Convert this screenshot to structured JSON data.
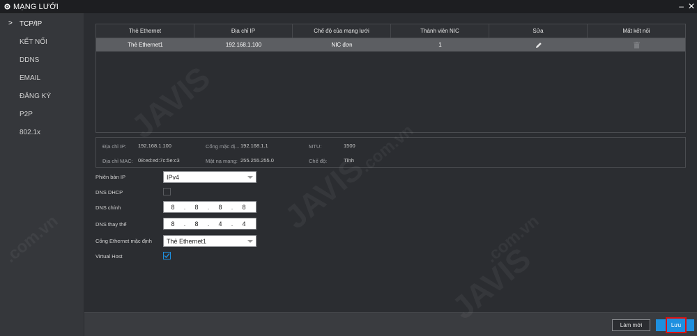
{
  "window": {
    "title": "MẠNG LƯỚI",
    "controls": {
      "minimize": "–",
      "close": "✕"
    }
  },
  "sidebar": {
    "items": [
      {
        "label": "TCP/IP",
        "active": true
      },
      {
        "label": "KẾT NỐI",
        "active": false
      },
      {
        "label": "DDNS",
        "active": false
      },
      {
        "label": "EMAIL",
        "active": false
      },
      {
        "label": "ĐĂNG KÝ",
        "active": false
      },
      {
        "label": "P2P",
        "active": false
      },
      {
        "label": "802.1x",
        "active": false
      }
    ]
  },
  "table": {
    "headers": [
      "Thẻ Ethernet",
      "Địa chỉ IP",
      "Chế độ của mạng lưới",
      "Thành viên NIC",
      "Sửa",
      "Mất kết nối"
    ],
    "rows": [
      {
        "card": "Thẻ Ethernet1",
        "ip": "192.168.1.100",
        "mode": "NIC đơn",
        "members": "1",
        "edit_icon": "pencil-icon",
        "disconnect_icon": "trash-icon"
      }
    ]
  },
  "info": {
    "ip_label": "Địa chỉ IP:",
    "ip_value": "192.168.1.100",
    "mac_label": "Địa chỉ MAC:",
    "mac_value": "08:ed:ed:7c:5e:c3",
    "gateway_label": "Cổng mặc đị...",
    "gateway_value": "192.168.1.1",
    "subnet_label": "Mặt nạ mạng:",
    "subnet_value": "255.255.255.0",
    "mtu_label": "MTU:",
    "mtu_value": "1500",
    "mode_label": "Chế độ:",
    "mode_value": "Tĩnh"
  },
  "form": {
    "ip_version": {
      "label": "Phiên bản IP",
      "value": "IPv4"
    },
    "dns_dhcp": {
      "label": "DNS DHCP",
      "checked": false
    },
    "dns_primary": {
      "label": "DNS chính",
      "octets": [
        "8",
        "8",
        "8",
        "8"
      ]
    },
    "dns_secondary": {
      "label": "DNS thay thế",
      "octets": [
        "8",
        "8",
        "4",
        "4"
      ]
    },
    "default_gateway": {
      "label": "Cổng Ethernet mặc định",
      "value": "Thẻ Ethernet1"
    },
    "virtual_host": {
      "label": "Virtual Host",
      "checked": true
    }
  },
  "footer": {
    "refresh_label": "Làm mới",
    "save_label": "Lưu"
  },
  "watermark": {
    "brand": "JAVIS",
    "suffix": ".com.vn"
  },
  "colors": {
    "accent": "#1e90e0",
    "highlight_border": "#e01010",
    "selected_row": "#5c5e62"
  }
}
